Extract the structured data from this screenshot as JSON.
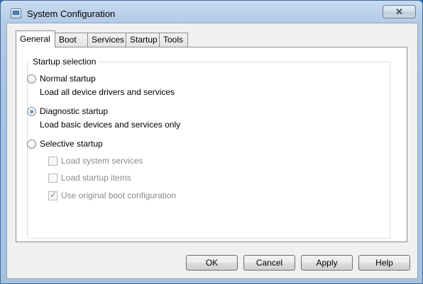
{
  "window": {
    "title": "System Configuration",
    "close_label": "✕"
  },
  "tabs": [
    {
      "label": "General",
      "active": true
    },
    {
      "label": "Boot",
      "active": false
    },
    {
      "label": "Services",
      "active": false
    },
    {
      "label": "Startup",
      "active": false
    },
    {
      "label": "Tools",
      "active": false
    }
  ],
  "startup_selection": {
    "group_label": "Startup selection",
    "normal": {
      "label": "Normal startup",
      "description": "Load all device drivers and services",
      "selected": false
    },
    "diagnostic": {
      "label": "Diagnostic startup",
      "description": "Load basic devices and services only",
      "selected": true
    },
    "selective": {
      "label": "Selective startup",
      "selected": false
    },
    "options": {
      "load_system_services": {
        "label": "Load system services",
        "checked": false,
        "enabled": false
      },
      "load_startup_items": {
        "label": "Load startup items",
        "checked": false,
        "enabled": false
      },
      "use_original_boot": {
        "label": "Use original boot configuration",
        "checked": true,
        "enabled": false
      }
    }
  },
  "buttons": {
    "ok": "OK",
    "cancel": "Cancel",
    "apply": "Apply",
    "help": "Help"
  }
}
